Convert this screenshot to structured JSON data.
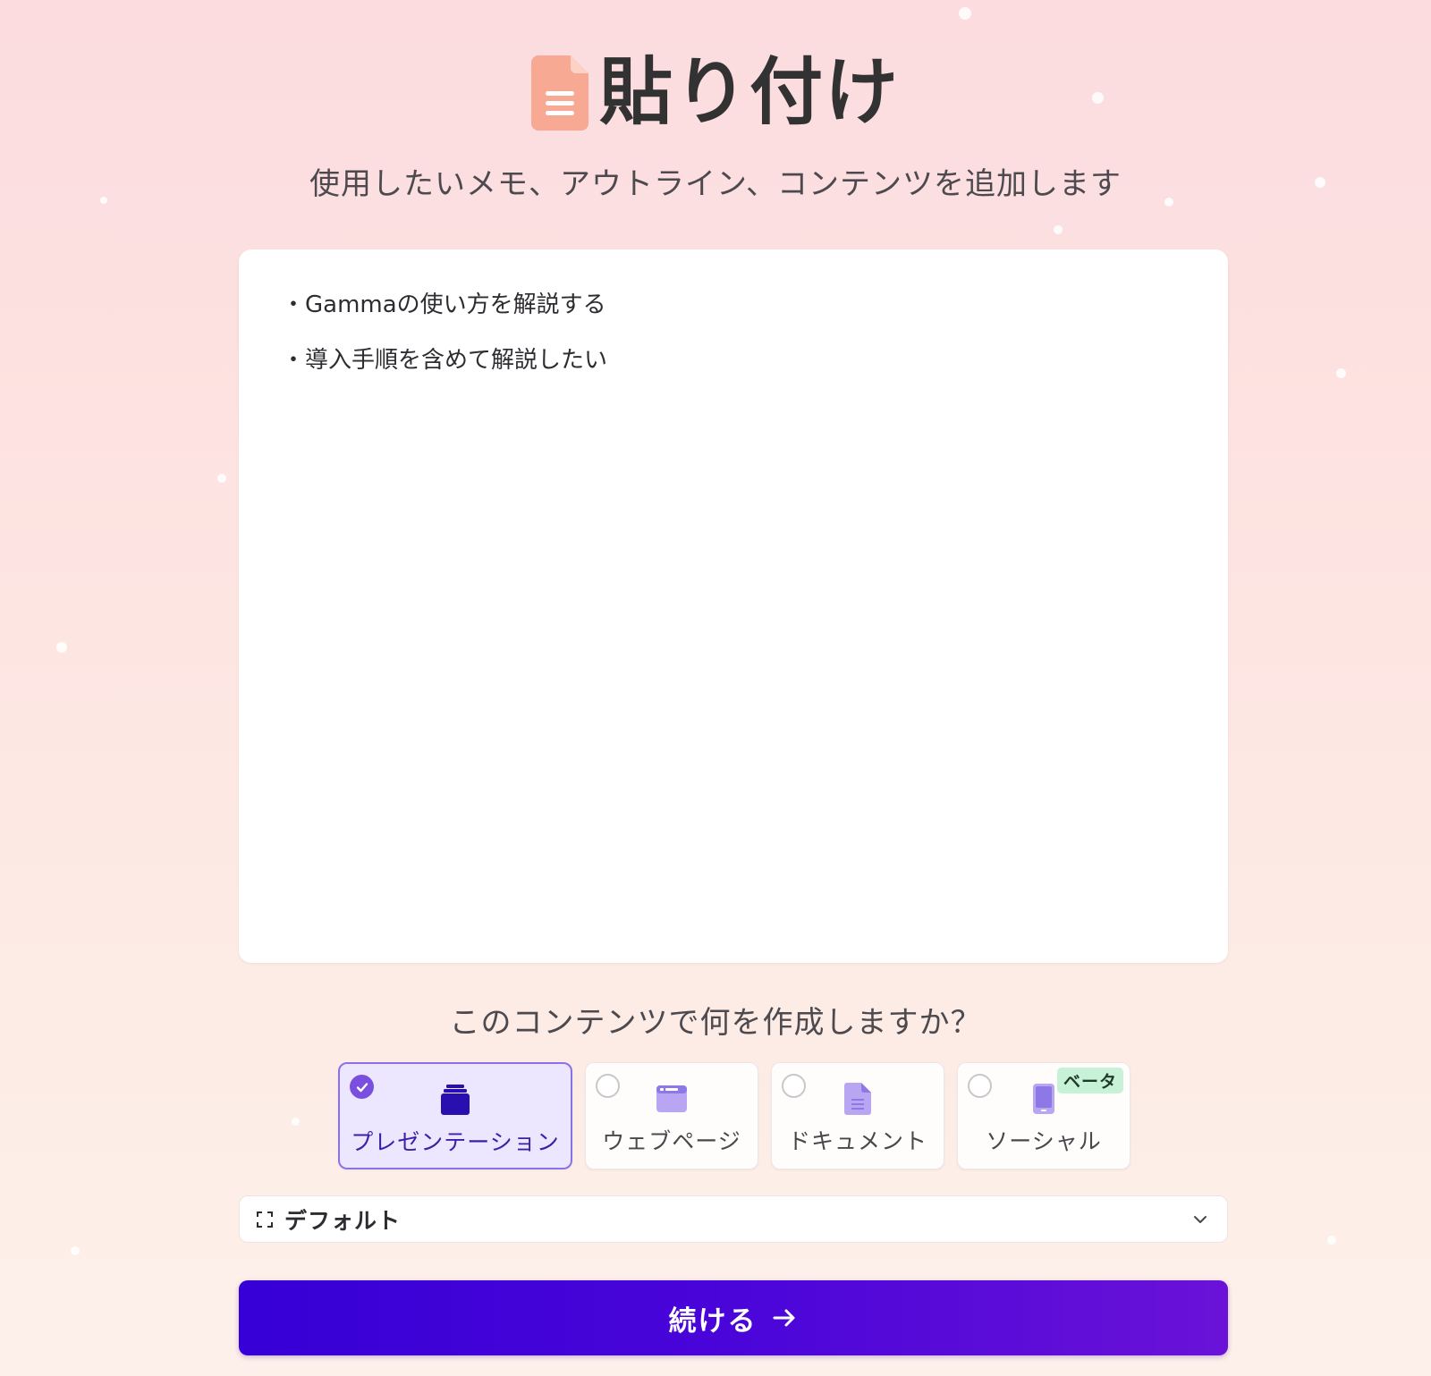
{
  "header": {
    "title": "貼り付け",
    "subtitle": "使用したいメモ、アウトライン、コンテンツを追加します",
    "icon": "document-icon"
  },
  "editor": {
    "lines": [
      "・Gammaの使い方を解説する",
      "・導入手順を含めて解説したい"
    ]
  },
  "question": "このコンテンツで何を作成しますか？",
  "options": [
    {
      "label": "プレゼンテーション",
      "icon": "presentation-icon",
      "selected": true
    },
    {
      "label": "ウェブページ",
      "icon": "webpage-icon",
      "selected": false
    },
    {
      "label": "ドキュメント",
      "icon": "document-icon",
      "selected": false
    },
    {
      "label": "ソーシャル",
      "icon": "phone-icon",
      "selected": false,
      "badge": "ベータ"
    }
  ],
  "format_select": {
    "value": "デフォルト",
    "icon": "frame-icon"
  },
  "continue_button": {
    "label": "続ける",
    "icon": "arrow-right-icon"
  },
  "colors": {
    "accent": "#3600d6",
    "selected_bg": "#ede6ff",
    "badge_bg": "#c8f2d8",
    "title_icon": "#f8a994"
  }
}
